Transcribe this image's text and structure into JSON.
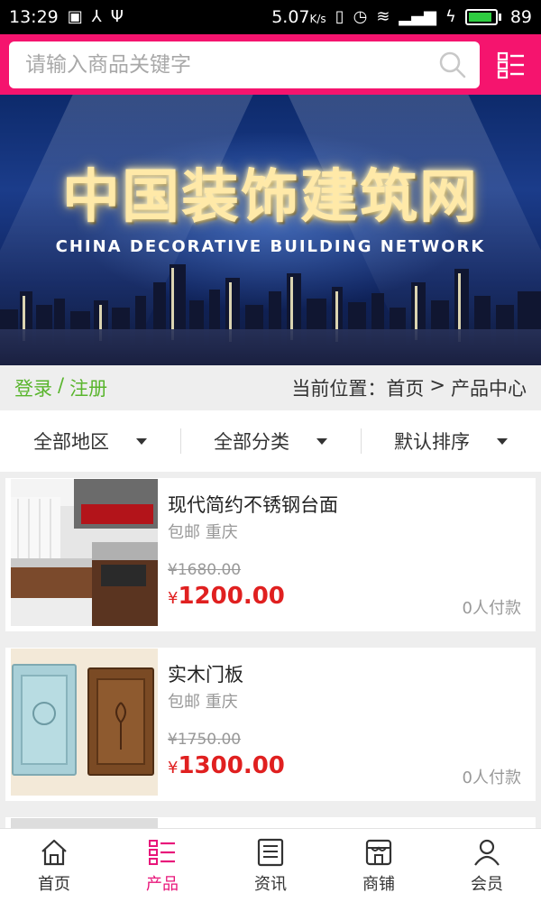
{
  "status_bar": {
    "time": "13:29",
    "speed": "5.07",
    "speed_unit": "K/s",
    "battery": "89"
  },
  "search": {
    "placeholder": "请输入商品关键字"
  },
  "banner": {
    "title": "中国装饰建筑网",
    "subtitle": "CHINA DECORATIVE BUILDING NETWORK"
  },
  "auth": {
    "login": "登录",
    "separator": "/",
    "register": "注册"
  },
  "breadcrumb": {
    "prefix": "当前位置：",
    "home": "首页",
    "sep": ">",
    "current": "产品中心"
  },
  "filters": [
    {
      "label": "全部地区"
    },
    {
      "label": "全部分类"
    },
    {
      "label": "默认排序"
    }
  ],
  "products": [
    {
      "name": "现代简约不锈钢台面",
      "shipping": "包邮 重庆",
      "old_price": "¥1680.00",
      "currency": "¥",
      "price": "1200.00",
      "sold": "0人付款"
    },
    {
      "name": "实木门板",
      "shipping": "包邮 重庆",
      "old_price": "¥1750.00",
      "currency": "¥",
      "price": "1300.00",
      "sold": "0人付款"
    }
  ],
  "nav": [
    {
      "label": "首页",
      "icon": "home-icon"
    },
    {
      "label": "产品",
      "icon": "product-list-icon",
      "active": true
    },
    {
      "label": "资讯",
      "icon": "news-icon"
    },
    {
      "label": "商铺",
      "icon": "store-icon"
    },
    {
      "label": "会员",
      "icon": "user-icon"
    }
  ],
  "colors": {
    "accent": "#f5146e",
    "price": "#e02020",
    "login": "#59b52d"
  }
}
